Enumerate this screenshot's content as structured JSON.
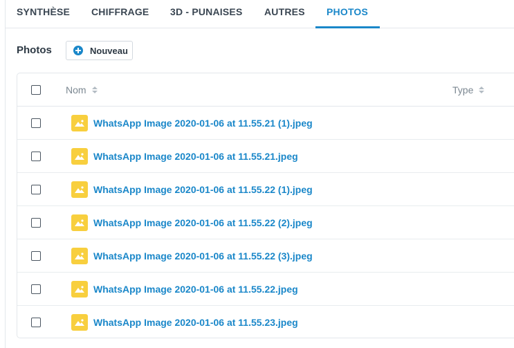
{
  "tabs": [
    {
      "label": "SYNTHÈSE",
      "active": false
    },
    {
      "label": "CHIFFRAGE",
      "active": false
    },
    {
      "label": "3D - PUNAISES",
      "active": false
    },
    {
      "label": "AUTRES",
      "active": false
    },
    {
      "label": "PHOTOS",
      "active": true
    }
  ],
  "section": {
    "title": "Photos",
    "new_button_label": "Nouveau"
  },
  "table": {
    "columns": [
      {
        "label": "Nom",
        "sortable": true
      },
      {
        "label": "Type",
        "sortable": true
      }
    ],
    "rows": [
      {
        "name": "WhatsApp Image 2020-01-06 at 11.55.21 (1).jpeg",
        "icon": "image-file-icon"
      },
      {
        "name": "WhatsApp Image 2020-01-06 at 11.55.21.jpeg",
        "icon": "image-file-icon"
      },
      {
        "name": "WhatsApp Image 2020-01-06 at 11.55.22 (1).jpeg",
        "icon": "image-file-icon"
      },
      {
        "name": "WhatsApp Image 2020-01-06 at 11.55.22 (2).jpeg",
        "icon": "image-file-icon"
      },
      {
        "name": "WhatsApp Image 2020-01-06 at 11.55.22 (3).jpeg",
        "icon": "image-file-icon"
      },
      {
        "name": "WhatsApp Image 2020-01-06 at 11.55.22.jpeg",
        "icon": "image-file-icon"
      },
      {
        "name": "WhatsApp Image 2020-01-06 at 11.55.23.jpeg",
        "icon": "image-file-icon"
      }
    ]
  },
  "colors": {
    "accent": "#1a87c9",
    "file_icon": "#f8cf3e",
    "text": "#2d3944",
    "muted": "#7b8791"
  }
}
